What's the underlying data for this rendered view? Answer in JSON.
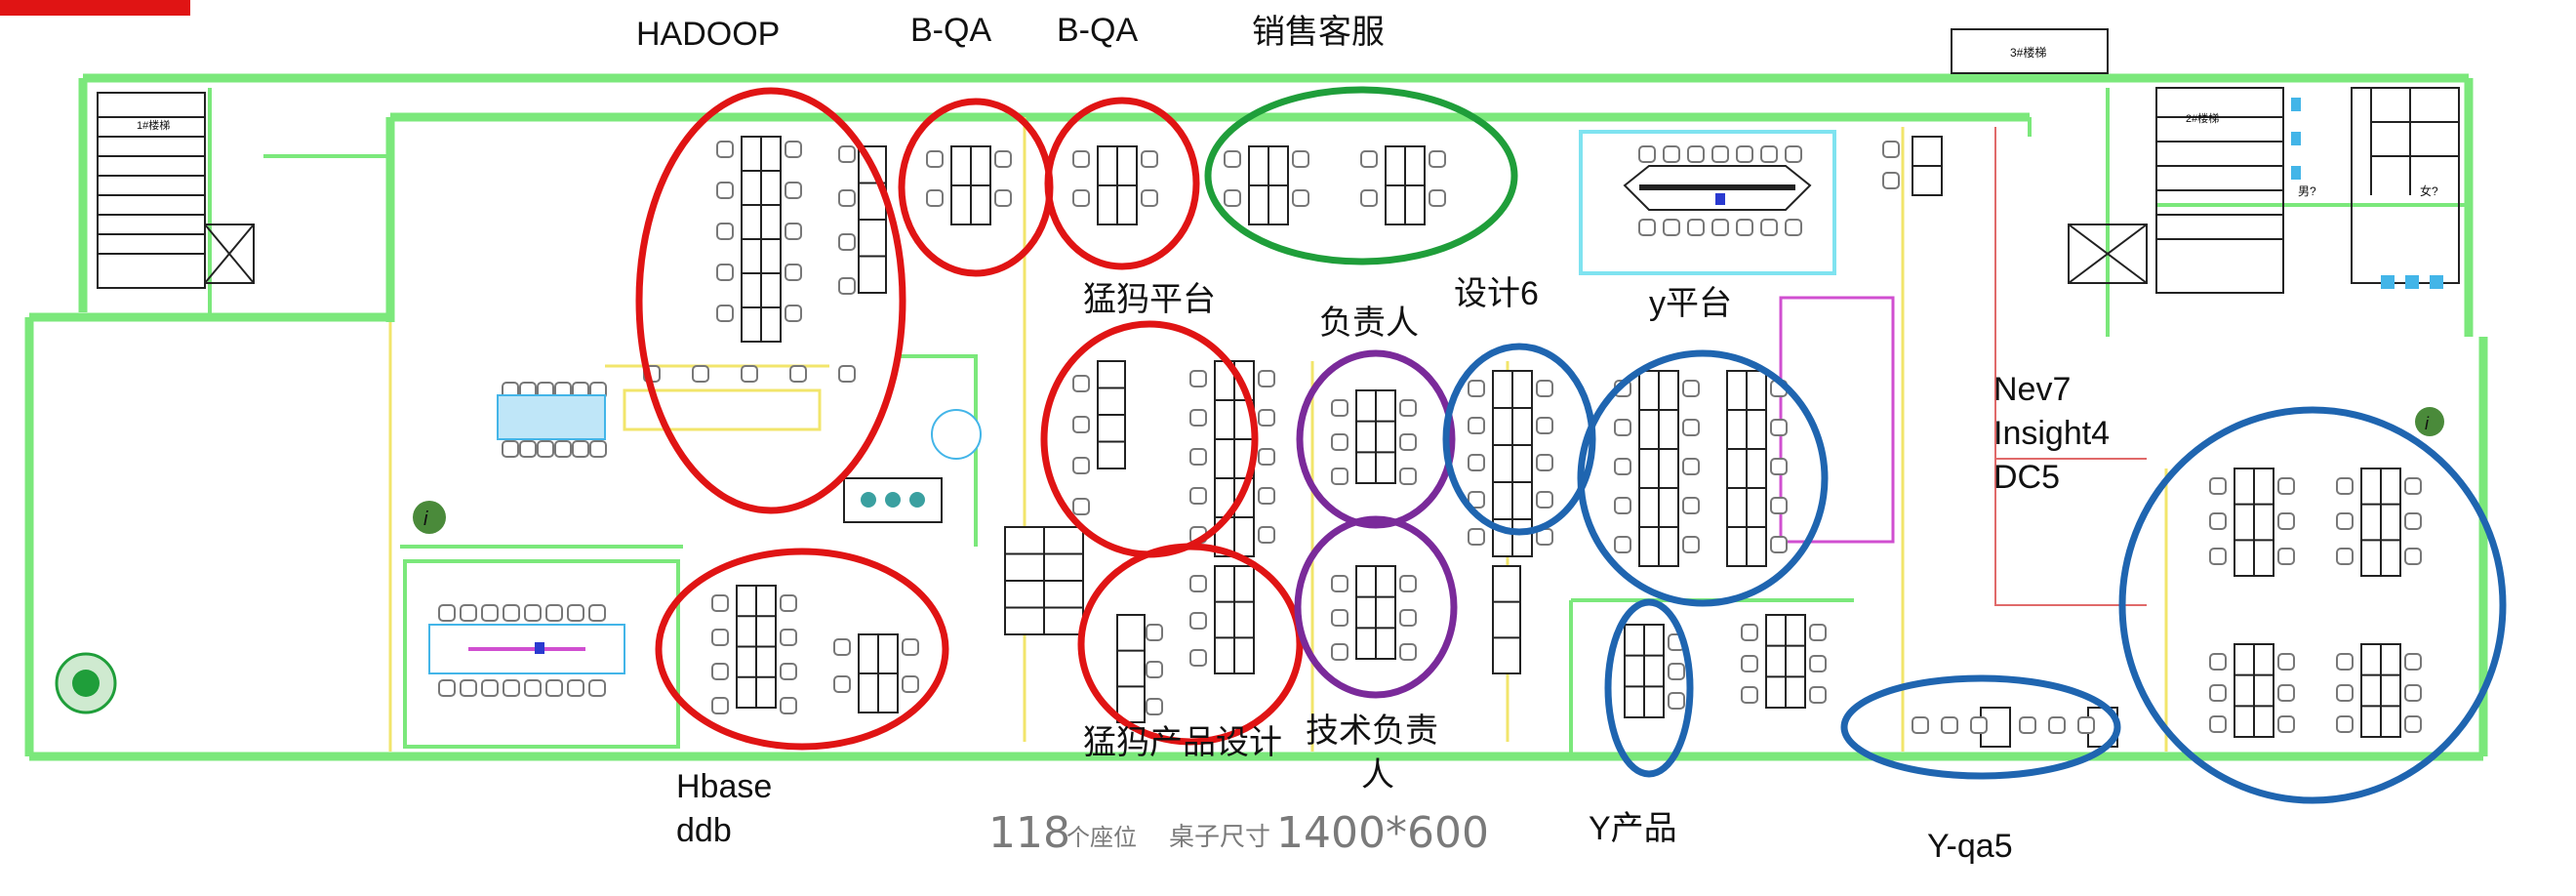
{
  "colors": {
    "wall": "#7be87b",
    "wall_dark": "#5cd65c",
    "furniture": "#222222",
    "cyan_wall": "#7fe3f0",
    "red_zone": "#e01414",
    "green_zone": "#1f9e3a",
    "purple_zone": "#7a2a9a",
    "blue_zone": "#1f65b0",
    "yellow": "#f2e56b",
    "magenta": "#d04fd0",
    "meeting_blue": "#43b5e8",
    "note_gray": "#7a7a7a"
  },
  "labels": {
    "hadoop": "HADOOP",
    "bqa1": "B-QA",
    "bqa2": "B-QA",
    "sales": "销售客服",
    "mengma_platform": "猛犸平台",
    "lead": "负责人",
    "design6": "设计6",
    "y_platform": "y平台",
    "nev7": "Nev7",
    "insight4": "Insight4",
    "dc5": "DC5",
    "hbase": "Hbase",
    "ddb": "ddb",
    "mengma_design": "猛犸产品设计",
    "tech_lead_1": "技术负责",
    "tech_lead_2": "人",
    "y_product": "Y产品",
    "yqa5": "Y-qa5"
  },
  "note": {
    "seats": "118",
    "seat_unit": "个座位",
    "desk_label": "桌子尺寸",
    "desk_size": "1400*600"
  },
  "plan_marks": {
    "stair1": "1#楼梯",
    "stair2": "2#楼梯",
    "stair3": "3#楼梯",
    "men": "男?",
    "women": "女?"
  },
  "zones": [
    {
      "name": "hadoop",
      "group": "red"
    },
    {
      "name": "b-qa-1",
      "group": "red"
    },
    {
      "name": "b-qa-2",
      "group": "red"
    },
    {
      "name": "sales",
      "group": "green"
    },
    {
      "name": "mengma-platform",
      "group": "red"
    },
    {
      "name": "mengma-design",
      "group": "red"
    },
    {
      "name": "hbase",
      "group": "red"
    },
    {
      "name": "lead",
      "group": "purple"
    },
    {
      "name": "tech-lead",
      "group": "purple"
    },
    {
      "name": "design6",
      "group": "blue"
    },
    {
      "name": "y-platform",
      "group": "blue"
    },
    {
      "name": "y-product",
      "group": "blue"
    },
    {
      "name": "y-qa5",
      "group": "blue"
    },
    {
      "name": "nev-insight-dc",
      "group": "blue"
    }
  ]
}
